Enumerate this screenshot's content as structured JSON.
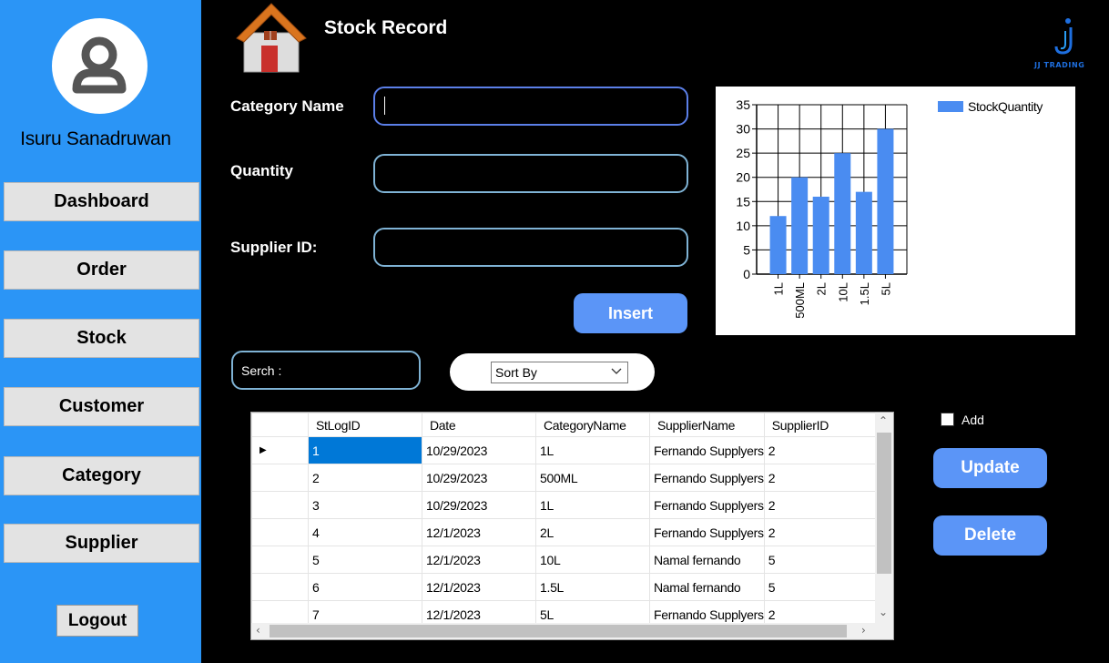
{
  "user": {
    "name": "Isuru Sanadruwan"
  },
  "nav": {
    "items": [
      {
        "label": "Dashboard"
      },
      {
        "label": "Order"
      },
      {
        "label": "Stock"
      },
      {
        "label": "Customer"
      },
      {
        "label": "Category"
      },
      {
        "label": "Supplier"
      }
    ],
    "logout": "Logout"
  },
  "header": {
    "title": "Stock Record",
    "brand": "JJ TRADING"
  },
  "form": {
    "category_label": "Category Name",
    "quantity_label": "Quantity",
    "supplier_label": "Supplier ID:",
    "category_value": "",
    "quantity_value": "",
    "supplier_value": "",
    "insert_label": "Insert"
  },
  "search": {
    "label": "Serch :",
    "value": ""
  },
  "sort": {
    "selected": "Sort By"
  },
  "grid": {
    "columns": [
      "StLogID",
      "Date",
      "CategoryName",
      "SupplierName",
      "SupplierID"
    ],
    "rows": [
      [
        "1",
        "10/29/2023",
        "1L",
        "Fernando Supplyers",
        "2"
      ],
      [
        "2",
        "10/29/2023",
        "500ML",
        "Fernando Supplyers",
        "2"
      ],
      [
        "3",
        "10/29/2023",
        "1L",
        "Fernando Supplyers",
        "2"
      ],
      [
        "4",
        "12/1/2023",
        "2L",
        "Fernando Supplyers",
        "2"
      ],
      [
        "5",
        "12/1/2023",
        "10L",
        "Namal fernando",
        "5"
      ],
      [
        "6",
        "12/1/2023",
        "1.5L",
        "Namal fernando",
        "5"
      ],
      [
        "7",
        "12/1/2023",
        "5L",
        "Fernando Supplyers",
        "2"
      ]
    ],
    "current_row_marker": "▶"
  },
  "actions": {
    "add_label": "Add",
    "add_checked": false,
    "update_label": "Update",
    "delete_label": "Delete"
  },
  "colors": {
    "sidebar": "#2b95f6",
    "accent_button": "#5b95f7",
    "bar": "#4a8cf1",
    "selection": "#0078d7"
  },
  "chart_data": {
    "type": "bar",
    "categories": [
      "1L",
      "500ML",
      "2L",
      "10L",
      "1.5L",
      "5L"
    ],
    "series": [
      {
        "name": "StockQuantity",
        "values": [
          12,
          20,
          16,
          25,
          17,
          30
        ]
      }
    ],
    "y_ticks": [
      "0",
      "5",
      "10",
      "15",
      "20",
      "25",
      "30",
      "35"
    ],
    "ylim": [
      0,
      35
    ],
    "grid": true,
    "legend": "top-right"
  }
}
